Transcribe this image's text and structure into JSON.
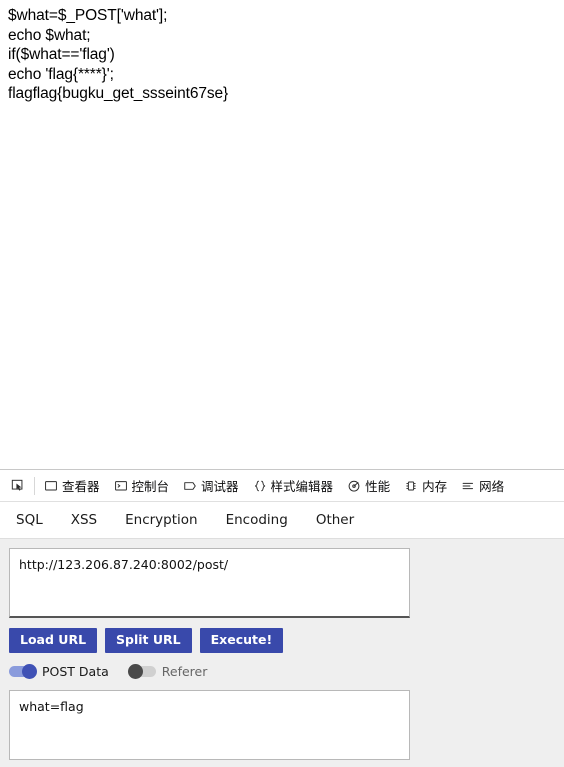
{
  "page_content": {
    "lines": [
      "$what=$_POST['what'];",
      "echo $what;",
      "if($what=='flag')",
      "echo 'flag{****}';",
      "flagflag{bugku_get_ssseint67se}"
    ]
  },
  "devtools": {
    "picker_icon": "element-picker-icon",
    "tabs": [
      {
        "label": "查看器",
        "icon": "inspector-icon"
      },
      {
        "label": "控制台",
        "icon": "console-icon"
      },
      {
        "label": "调试器",
        "icon": "debugger-icon"
      },
      {
        "label": "样式编辑器",
        "icon": "style-editor-icon"
      },
      {
        "label": "性能",
        "icon": "performance-icon"
      },
      {
        "label": "内存",
        "icon": "memory-icon"
      },
      {
        "label": "网络",
        "icon": "network-icon"
      }
    ]
  },
  "hackbar": {
    "tabs": [
      {
        "label": "SQL"
      },
      {
        "label": "XSS"
      },
      {
        "label": "Encryption"
      },
      {
        "label": "Encoding"
      },
      {
        "label": "Other"
      }
    ],
    "url_input": {
      "value": "http://123.206.87.240:8002/post/",
      "placeholder": ""
    },
    "buttons": [
      {
        "label": "Load URL"
      },
      {
        "label": "Split URL"
      },
      {
        "label": "Execute!"
      }
    ],
    "toggles": [
      {
        "label": "POST Data",
        "state": "on"
      },
      {
        "label": "Referer",
        "state": "off"
      }
    ],
    "post_data": {
      "value": "what=flag",
      "placeholder": ""
    },
    "accent_color": "#3949ab"
  }
}
